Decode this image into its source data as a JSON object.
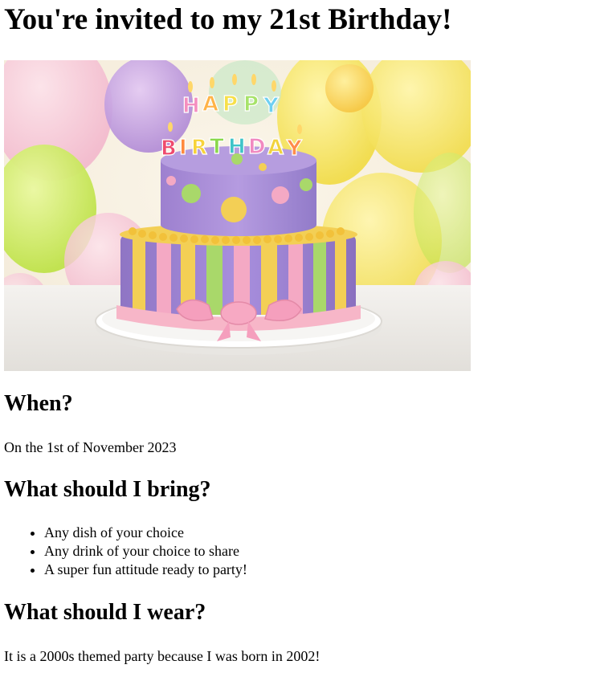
{
  "heading": "You're invited to my 21st Birthday!",
  "image": {
    "name": "birthday-cake-image",
    "candle_letters": "HAPPY BIRTHDAY",
    "colors": {
      "cake_purple": "#a98bd8",
      "stripe_yellow": "#f3cf55",
      "stripe_pink": "#f4a9c4",
      "stripe_green": "#a9d86a",
      "ribbon_pink": "#f7b6c8"
    }
  },
  "when": {
    "title": "When?",
    "text": "On the 1st of November 2023"
  },
  "bring": {
    "title": "What should I bring?",
    "items": [
      "Any dish of your choice",
      "Any drink of your choice to share",
      "A super fun attitude ready to party!"
    ]
  },
  "wear": {
    "title": "What should I wear?",
    "text": "It is a 2000s themed party because I was born in 2002!"
  }
}
